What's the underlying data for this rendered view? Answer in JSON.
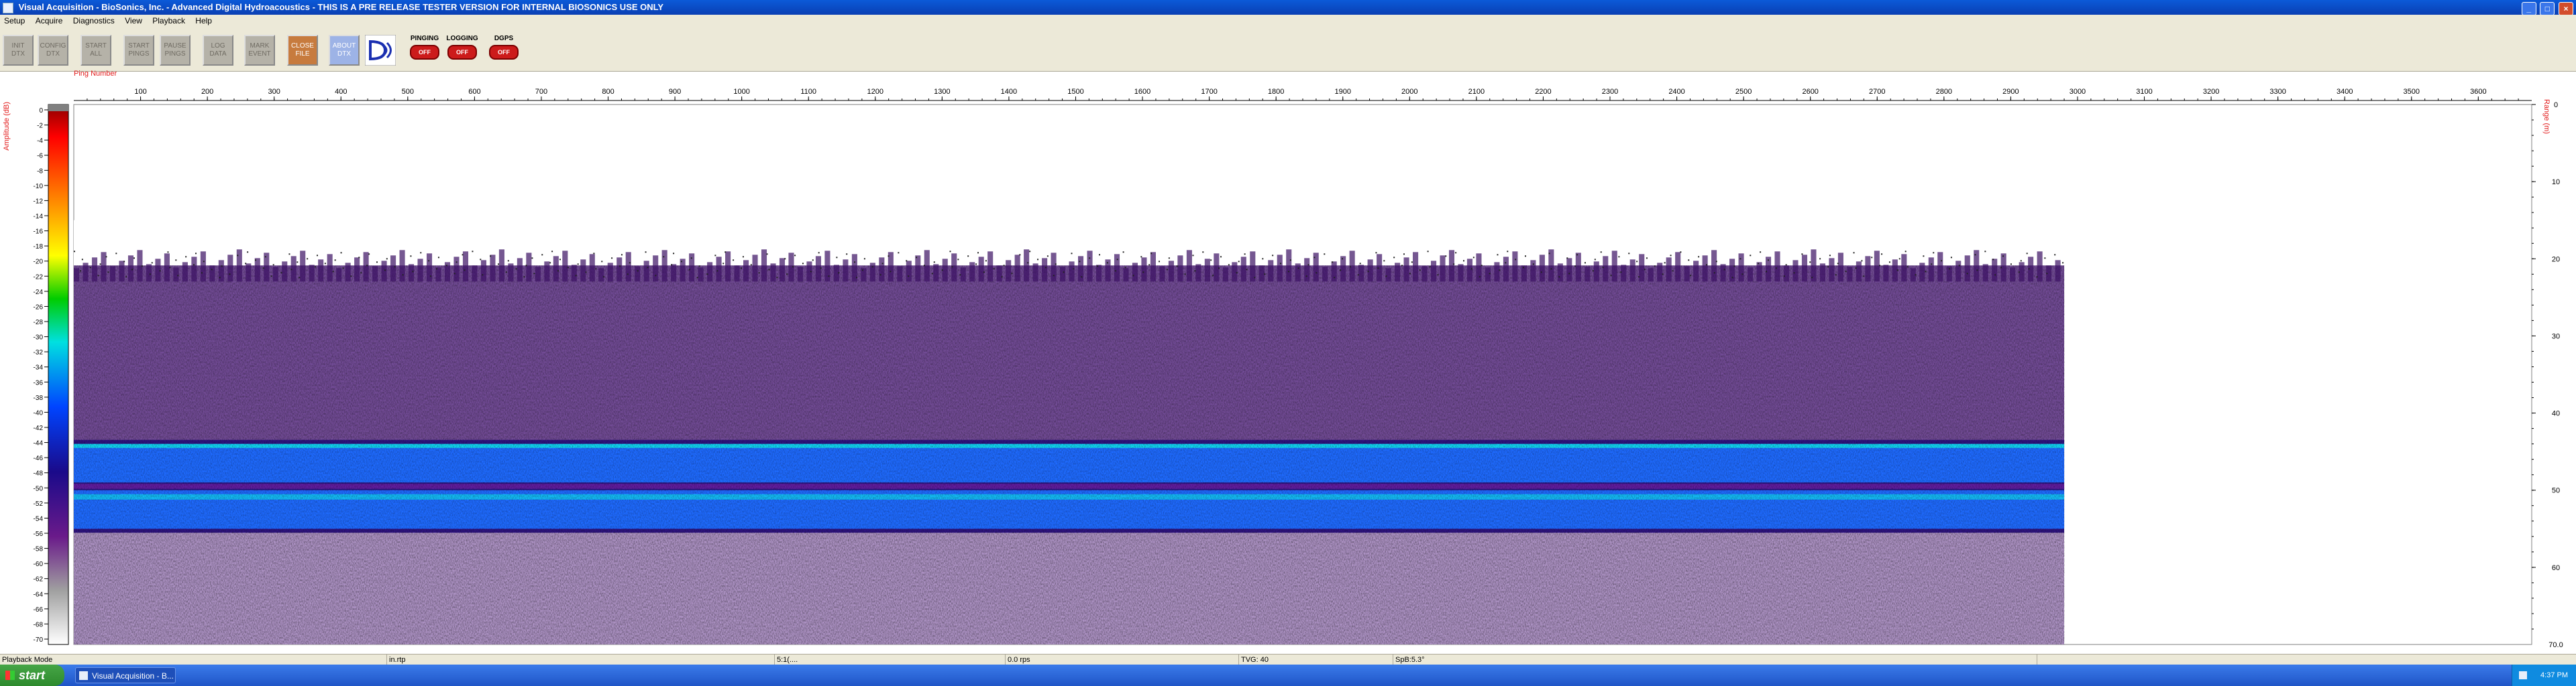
{
  "window": {
    "title": "Visual Acquisition - BioSonics, Inc. - Advanced Digital Hydroacoustics - THIS IS A PRE RELEASE TESTER VERSION FOR INTERNAL BIOSONICS USE ONLY",
    "minimize": "_",
    "maximize": "□",
    "close": "×"
  },
  "menu": [
    "Setup",
    "Acquire",
    "Diagnostics",
    "View",
    "Playback",
    "Help"
  ],
  "toolbar": {
    "buttons": [
      {
        "line1": "INIT",
        "line2": "DTX"
      },
      {
        "line1": "CONFIG",
        "line2": "DTX"
      },
      {
        "line1": "START",
        "line2": "ALL"
      },
      {
        "line1": "START",
        "line2": "PINGS"
      },
      {
        "line1": "PAUSE",
        "line2": "PINGS"
      },
      {
        "line1": "LOG",
        "line2": "DATA"
      },
      {
        "line1": "MARK",
        "line2": "EVENT"
      },
      {
        "line1": "CLOSE",
        "line2": "FILE"
      },
      {
        "line1": "ABOUT",
        "line2": "DTX"
      }
    ],
    "indicators": [
      {
        "label": "PINGING",
        "state": "OFF"
      },
      {
        "label": "LOGGING",
        "state": "OFF"
      },
      {
        "label": "DGPS",
        "state": "OFF"
      }
    ]
  },
  "echogram": {
    "x_axis_title": "Ping Number",
    "y_left_title": "Amplitude (dB)",
    "y_right_title": "Range (m)",
    "x_ticks": [
      100,
      200,
      300,
      400,
      500,
      600,
      700,
      800,
      900,
      1000,
      1100,
      1200,
      1300,
      1400,
      1500,
      1600,
      1700,
      1800,
      1900,
      2000,
      2100,
      2200,
      2300,
      2400,
      2500,
      2600,
      2700,
      2800,
      2900,
      3000,
      3100,
      3200,
      3300,
      3400,
      3500,
      3600
    ],
    "x_range": [
      0,
      3680
    ],
    "data_pings": 2980,
    "amplitude_ticks": [
      0,
      -2,
      -4,
      -6,
      -8,
      -10,
      -12,
      -14,
      -16,
      -18,
      -20,
      -22,
      -24,
      -26,
      -28,
      -30,
      -32,
      -34,
      -36,
      -38,
      -40,
      -42,
      -44,
      -46,
      -48,
      -50,
      -52,
      -54,
      -56,
      -58,
      -60,
      -62,
      -64,
      -66,
      -68,
      -70
    ],
    "amplitude_range": [
      0,
      -70
    ],
    "range_ticks": [
      0,
      10,
      20,
      30,
      40,
      50,
      60
    ],
    "range_end_label": "70.0",
    "range_max": 70,
    "surface_noise_top_m": 20,
    "band_upper_m": [
      44,
      49
    ],
    "band_lower_m": [
      50,
      55
    ]
  },
  "status_bar": [
    {
      "text": "Playback Mode"
    },
    {
      "text": "in.rtp"
    },
    {
      "text": "5:1(...."
    },
    {
      "text": "0.0 rps"
    },
    {
      "text": "TVG: 40"
    },
    {
      "text": "SpB:5.3°"
    },
    {
      "text": ""
    }
  ],
  "taskbar": {
    "start": "start",
    "task": "Visual Acquisition - B...",
    "clock": "4:37 PM"
  },
  "colors": {
    "titlebar": "#0a3fb3",
    "chrome": "#ece9d8",
    "axis_label": "#e21b1b",
    "echo_purple": "#5d1f8c",
    "echo_blue": "#1f6bff",
    "echo_cyan": "#11d4f2"
  }
}
